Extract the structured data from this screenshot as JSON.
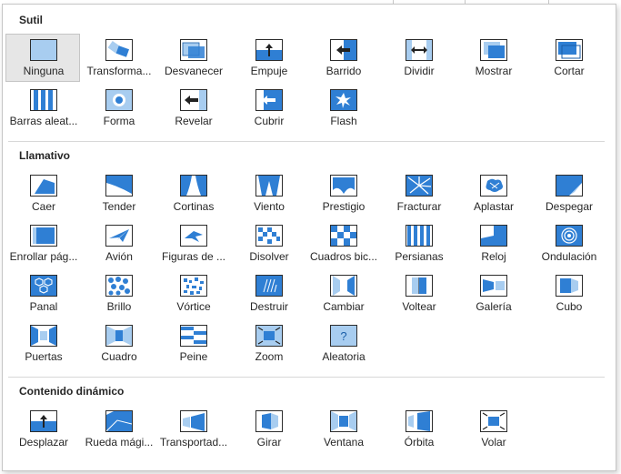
{
  "sections": [
    {
      "title": "Sutil",
      "items": [
        {
          "label": "Ninguna",
          "icon": "none-transition-icon",
          "name": "transition-ninguna",
          "selected": true
        },
        {
          "label": "Transforma...",
          "icon": "morph-transition-icon",
          "name": "transition-transformacion"
        },
        {
          "label": "Desvanecer",
          "icon": "fade-transition-icon",
          "name": "transition-desvanecer"
        },
        {
          "label": "Empuje",
          "icon": "push-transition-icon",
          "name": "transition-empuje"
        },
        {
          "label": "Barrido",
          "icon": "wipe-transition-icon",
          "name": "transition-barrido"
        },
        {
          "label": "Dividir",
          "icon": "split-transition-icon",
          "name": "transition-dividir"
        },
        {
          "label": "Mostrar",
          "icon": "reveal-transition-icon",
          "name": "transition-mostrar"
        },
        {
          "label": "Cortar",
          "icon": "cut-transition-icon",
          "name": "transition-cortar"
        },
        {
          "label": "Barras aleat...",
          "icon": "random-bars-transition-icon",
          "name": "transition-barras-aleatorias"
        },
        {
          "label": "Forma",
          "icon": "shape-transition-icon",
          "name": "transition-forma"
        },
        {
          "label": "Revelar",
          "icon": "uncover-transition-icon",
          "name": "transition-revelar"
        },
        {
          "label": "Cubrir",
          "icon": "cover-transition-icon",
          "name": "transition-cubrir"
        },
        {
          "label": "Flash",
          "icon": "flash-transition-icon",
          "name": "transition-flash"
        }
      ]
    },
    {
      "title": "Llamativo",
      "items": [
        {
          "label": "Caer",
          "icon": "fall-over-transition-icon",
          "name": "transition-caer"
        },
        {
          "label": "Tender",
          "icon": "drape-transition-icon",
          "name": "transition-tender"
        },
        {
          "label": "Cortinas",
          "icon": "curtains-transition-icon",
          "name": "transition-cortinas"
        },
        {
          "label": "Viento",
          "icon": "wind-transition-icon",
          "name": "transition-viento"
        },
        {
          "label": "Prestigio",
          "icon": "prestige-transition-icon",
          "name": "transition-prestigio"
        },
        {
          "label": "Fracturar",
          "icon": "fracture-transition-icon",
          "name": "transition-fracturar"
        },
        {
          "label": "Aplastar",
          "icon": "crush-transition-icon",
          "name": "transition-aplastar"
        },
        {
          "label": "Despegar",
          "icon": "peel-off-transition-icon",
          "name": "transition-despegar"
        },
        {
          "label": "Enrollar pág...",
          "icon": "page-curl-transition-icon",
          "name": "transition-enrollar-pagina"
        },
        {
          "label": "Avión",
          "icon": "airplane-transition-icon",
          "name": "transition-avion"
        },
        {
          "label": "Figuras de ...",
          "icon": "origami-transition-icon",
          "name": "transition-figuras-de-papel"
        },
        {
          "label": "Disolver",
          "icon": "dissolve-transition-icon",
          "name": "transition-disolver"
        },
        {
          "label": "Cuadros bic...",
          "icon": "checkerboard-transition-icon",
          "name": "transition-cuadros-bicolores"
        },
        {
          "label": "Persianas",
          "icon": "blinds-transition-icon",
          "name": "transition-persianas"
        },
        {
          "label": "Reloj",
          "icon": "clock-transition-icon",
          "name": "transition-reloj"
        },
        {
          "label": "Ondulación",
          "icon": "ripple-transition-icon",
          "name": "transition-ondulacion"
        },
        {
          "label": "Panal",
          "icon": "honeycomb-transition-icon",
          "name": "transition-panal"
        },
        {
          "label": "Brillo",
          "icon": "glitter-transition-icon",
          "name": "transition-brillo"
        },
        {
          "label": "Vórtice",
          "icon": "vortex-transition-icon",
          "name": "transition-vortice"
        },
        {
          "label": "Destruir",
          "icon": "shred-transition-icon",
          "name": "transition-destruir"
        },
        {
          "label": "Cambiar",
          "icon": "switch-transition-icon",
          "name": "transition-cambiar"
        },
        {
          "label": "Voltear",
          "icon": "flip-transition-icon",
          "name": "transition-voltear"
        },
        {
          "label": "Galería",
          "icon": "gallery-transition-icon",
          "name": "transition-galeria"
        },
        {
          "label": "Cubo",
          "icon": "cube-transition-icon",
          "name": "transition-cubo"
        },
        {
          "label": "Puertas",
          "icon": "doors-transition-icon",
          "name": "transition-puertas"
        },
        {
          "label": "Cuadro",
          "icon": "box-transition-icon",
          "name": "transition-cuadro"
        },
        {
          "label": "Peine",
          "icon": "comb-transition-icon",
          "name": "transition-peine"
        },
        {
          "label": "Zoom",
          "icon": "zoom-transition-icon",
          "name": "transition-zoom"
        },
        {
          "label": "Aleatoria",
          "icon": "random-transition-icon",
          "name": "transition-aleatoria"
        }
      ]
    },
    {
      "title": "Contenido dinámico",
      "items": [
        {
          "label": "Desplazar",
          "icon": "pan-transition-icon",
          "name": "transition-desplazar"
        },
        {
          "label": "Rueda mági...",
          "icon": "ferris-wheel-transition-icon",
          "name": "transition-rueda-magica"
        },
        {
          "label": "Transportad...",
          "icon": "conveyor-transition-icon",
          "name": "transition-transportador"
        },
        {
          "label": "Girar",
          "icon": "rotate-transition-icon",
          "name": "transition-girar"
        },
        {
          "label": "Ventana",
          "icon": "window-transition-icon",
          "name": "transition-ventana"
        },
        {
          "label": "Órbita",
          "icon": "orbit-transition-icon",
          "name": "transition-orbita"
        },
        {
          "label": "Volar",
          "icon": "fly-through-transition-icon",
          "name": "transition-volar"
        }
      ]
    }
  ],
  "colors": {
    "accent": "#2f7fd4",
    "accent_light": "#a8cdf0",
    "accent_dark": "#1a5ea8",
    "selected_bg": "#e6e6e6",
    "text": "#262626"
  }
}
